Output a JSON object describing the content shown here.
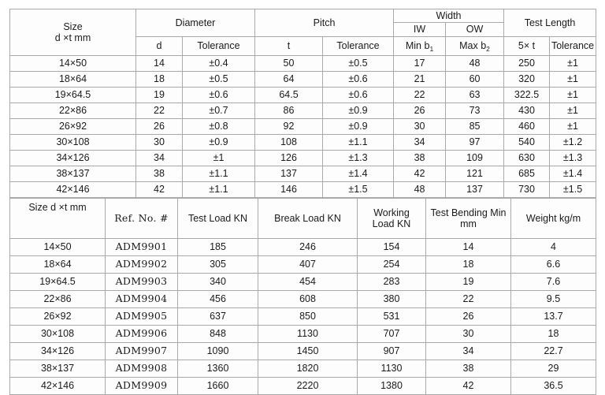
{
  "document": {
    "kind": "specification-tables",
    "table_count": 2
  },
  "table_dimensions": {
    "name": "Dimensions table",
    "group_headers": {
      "size": {
        "line1": "Size",
        "line2": "d ×t mm"
      },
      "diameter": "Diameter",
      "pitch": "Pitch",
      "width": "Width",
      "test_length": "Test Length"
    },
    "width_sub_groups": {
      "inner": "IW",
      "outer": "OW"
    },
    "sub_headers": {
      "d": "d",
      "d_tolerance": "Tolerance",
      "t": "t",
      "t_tolerance": "Tolerance",
      "min_b1_prefix": "Min b",
      "min_b1_sub": "1",
      "max_b2_prefix": "Max b",
      "max_b2_sub": "2",
      "five_t": "5× t",
      "length_tolerance": "Tolerance"
    },
    "rows": [
      {
        "size": "14×50",
        "d": "14",
        "d_tol": "±0.4",
        "t": "50",
        "t_tol": "±0.5",
        "min_b1": "17",
        "max_b2": "48",
        "five_t": "250",
        "len_tol": "±1"
      },
      {
        "size": "18×64",
        "d": "18",
        "d_tol": "±0.5",
        "t": "64",
        "t_tol": "±0.6",
        "min_b1": "21",
        "max_b2": "60",
        "five_t": "320",
        "len_tol": "±1"
      },
      {
        "size": "19×64.5",
        "d": "19",
        "d_tol": "±0.6",
        "t": "64.5",
        "t_tol": "±0.6",
        "min_b1": "22",
        "max_b2": "63",
        "five_t": "322.5",
        "len_tol": "±1"
      },
      {
        "size": "22×86",
        "d": "22",
        "d_tol": "±0.7",
        "t": "86",
        "t_tol": "±0.9",
        "min_b1": "26",
        "max_b2": "73",
        "five_t": "430",
        "len_tol": "±1"
      },
      {
        "size": "26×92",
        "d": "26",
        "d_tol": "±0.8",
        "t": "92",
        "t_tol": "±0.9",
        "min_b1": "30",
        "max_b2": "85",
        "five_t": "460",
        "len_tol": "±1"
      },
      {
        "size": "30×108",
        "d": "30",
        "d_tol": "±0.9",
        "t": "108",
        "t_tol": "±1.1",
        "min_b1": "34",
        "max_b2": "97",
        "five_t": "540",
        "len_tol": "±1.2"
      },
      {
        "size": "34×126",
        "d": "34",
        "d_tol": "±1",
        "t": "126",
        "t_tol": "±1.3",
        "min_b1": "38",
        "max_b2": "109",
        "five_t": "630",
        "len_tol": "±1.3"
      },
      {
        "size": "38×137",
        "d": "38",
        "d_tol": "±1.1",
        "t": "137",
        "t_tol": "±1.4",
        "min_b1": "42",
        "max_b2": "121",
        "five_t": "685",
        "len_tol": "±1.4"
      },
      {
        "size": "42×146",
        "d": "42",
        "d_tol": "±1.1",
        "t": "146",
        "t_tol": "±1.5",
        "min_b1": "48",
        "max_b2": "137",
        "five_t": "730",
        "len_tol": "±1.5"
      }
    ]
  },
  "table_loads": {
    "name": "Load and weight table",
    "headers": {
      "size": "Size d ×t mm",
      "ref_no": "Ref. No. #",
      "test_load": "Test Load KN",
      "break_load": "Break Load KN",
      "working_load_l1": "Working",
      "working_load_l2": "Load KN",
      "test_bending_l1": "Test Bending Min",
      "test_bending_l2": "mm",
      "weight": "Weight kg/m"
    },
    "rows": [
      {
        "size": "14×50",
        "ref": "ADM9901",
        "test_load": "185",
        "break_load": "246",
        "working_load": "154",
        "bending": "14",
        "weight": "4"
      },
      {
        "size": "18×64",
        "ref": "ADM9902",
        "test_load": "305",
        "break_load": "407",
        "working_load": "254",
        "bending": "18",
        "weight": "6.6"
      },
      {
        "size": "19×64.5",
        "ref": "ADM9903",
        "test_load": "340",
        "break_load": "454",
        "working_load": "283",
        "bending": "19",
        "weight": "7.6"
      },
      {
        "size": "22×86",
        "ref": "ADM9904",
        "test_load": "456",
        "break_load": "608",
        "working_load": "380",
        "bending": "22",
        "weight": "9.5"
      },
      {
        "size": "26×92",
        "ref": "ADM9905",
        "test_load": "637",
        "break_load": "850",
        "working_load": "531",
        "bending": "26",
        "weight": "13.7"
      },
      {
        "size": "30×108",
        "ref": "ADM9906",
        "test_load": "848",
        "break_load": "1130",
        "working_load": "707",
        "bending": "30",
        "weight": "18"
      },
      {
        "size": "34×126",
        "ref": "ADM9907",
        "test_load": "1090",
        "break_load": "1450",
        "working_load": "907",
        "bending": "34",
        "weight": "22.7"
      },
      {
        "size": "38×137",
        "ref": "ADM9908",
        "test_load": "1360",
        "break_load": "1820",
        "working_load": "1130",
        "bending": "38",
        "weight": "29"
      },
      {
        "size": "42×146",
        "ref": "ADM9909",
        "test_load": "1660",
        "break_load": "2220",
        "working_load": "1380",
        "bending": "42",
        "weight": "36.5"
      }
    ]
  },
  "colors": {
    "border": "#a9a9a9",
    "cell_background": "#fdfdfd",
    "text": "#1a1a1a",
    "page_background": "#ffffff"
  }
}
